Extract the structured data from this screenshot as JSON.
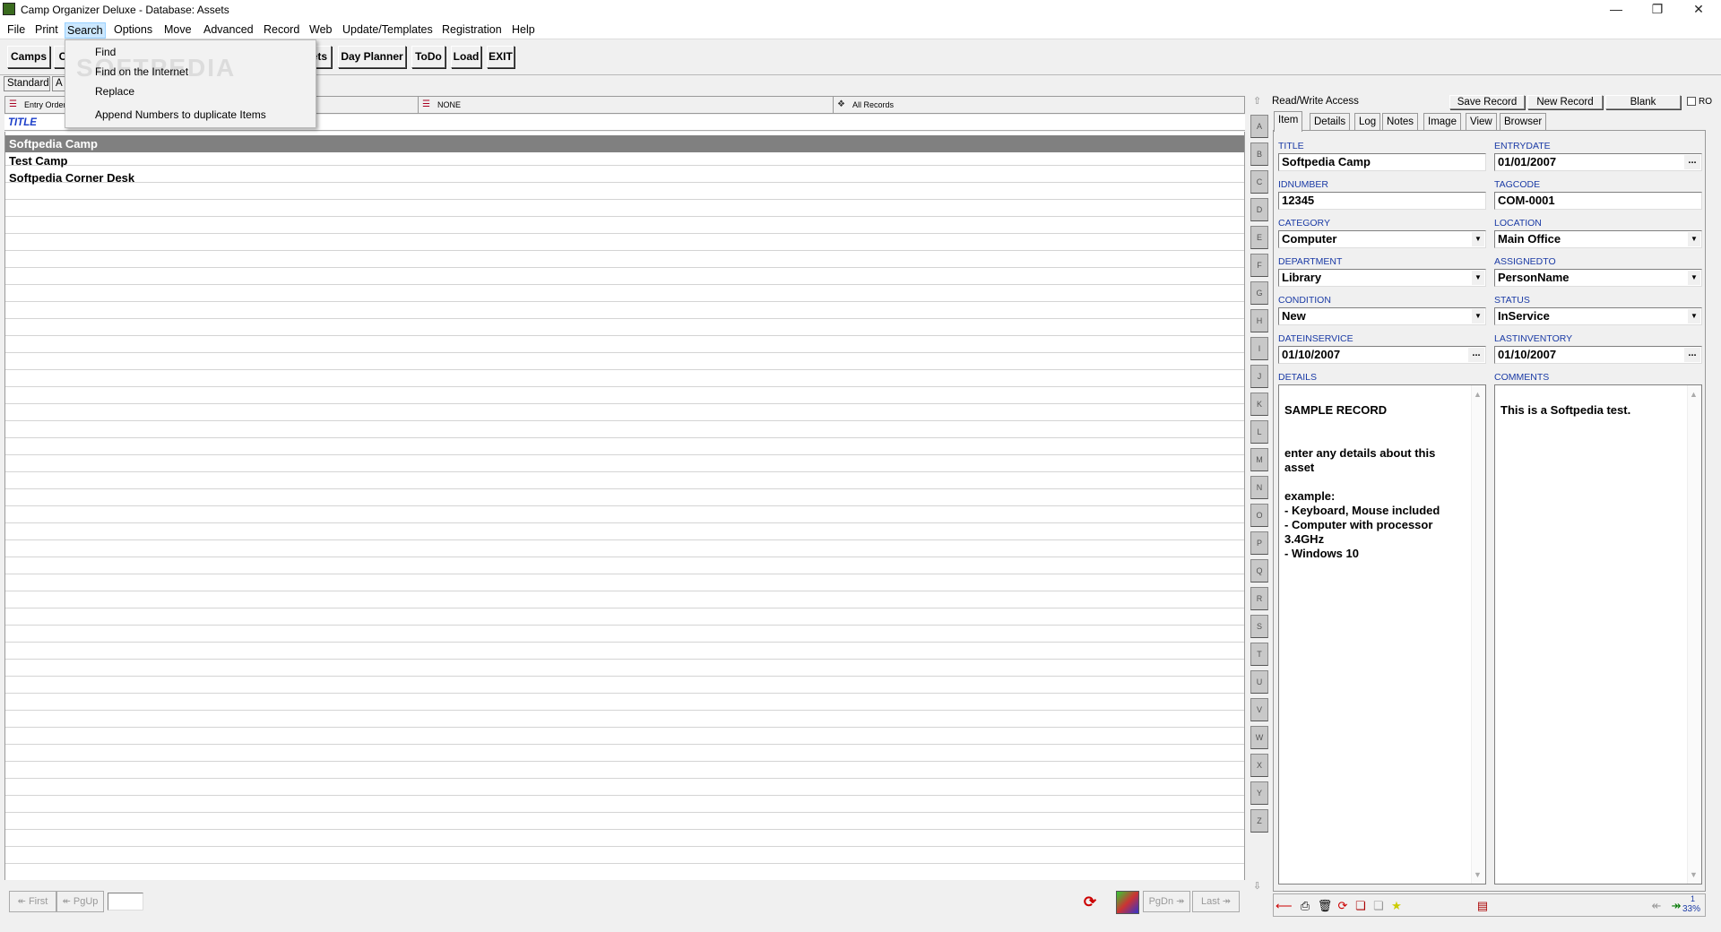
{
  "window": {
    "title": "Camp Organizer Deluxe - Database: Assets"
  },
  "menubar": [
    "File",
    "Print",
    "Search",
    "Options",
    "Move",
    "Advanced",
    "Record",
    "Web",
    "Update/Templates",
    "Registration",
    "Help"
  ],
  "search_menu": {
    "items": [
      "Find",
      "Find on the Internet",
      "Replace",
      "Append Numbers to duplicate Items"
    ],
    "watermark": "SOFTPEDIA"
  },
  "toolbar": {
    "camps": "Camps",
    "c_partial": "C",
    "ets_partial": "ets",
    "day_planner": "Day Planner",
    "todo": "ToDo",
    "load": "Load",
    "exit": "EXIT"
  },
  "viewbar": {
    "standard": "Standard",
    "a_partial": "A"
  },
  "list_header": {
    "order": "Entry Order",
    "filter": "NONE",
    "records": "All Records"
  },
  "column_title": "TITLE",
  "rows": [
    "Softpedia Camp",
    "Test Camp",
    "Softpedia Corner Desk"
  ],
  "alphabet": [
    "A",
    "B",
    "C",
    "D",
    "E",
    "F",
    "G",
    "H",
    "I",
    "J",
    "K",
    "L",
    "M",
    "N",
    "O",
    "P",
    "Q",
    "R",
    "S",
    "T",
    "U",
    "V",
    "W",
    "X",
    "Y",
    "Z"
  ],
  "bottom_nav": {
    "first": "First",
    "pgup": "PgUp",
    "pgdn": "PgDn",
    "last": "Last"
  },
  "record": {
    "access": "Read/Write Access",
    "save": "Save Record",
    "new": "New Record",
    "blank": "Blank",
    "ro": "RO",
    "tabs": [
      "Item",
      "Details",
      "Log",
      "Notes",
      "Image",
      "View",
      "Browser"
    ],
    "fields": {
      "title": {
        "label": "TITLE",
        "value": "Softpedia Camp"
      },
      "entrydate": {
        "label": "ENTRYDATE",
        "value": "01/01/2007"
      },
      "idnumber": {
        "label": "IDNUMBER",
        "value": "12345"
      },
      "tagcode": {
        "label": "TAGCODE",
        "value": "COM-0001"
      },
      "category": {
        "label": "CATEGORY",
        "value": "Computer"
      },
      "location": {
        "label": "LOCATION",
        "value": "Main Office"
      },
      "department": {
        "label": "DEPARTMENT",
        "value": "Library"
      },
      "assignedto": {
        "label": "ASSIGNEDTO",
        "value": "PersonName"
      },
      "condition": {
        "label": "CONDITION",
        "value": "New"
      },
      "status": {
        "label": "STATUS",
        "value": "InService"
      },
      "dateinservice": {
        "label": "DATEINSERVICE",
        "value": "01/10/2007"
      },
      "lastinventory": {
        "label": "LASTINVENTORY",
        "value": "01/10/2007"
      },
      "details": {
        "label": "DETAILS",
        "value": "SAMPLE RECORD\n\n\nenter any details about this asset\n\nexample:\n- Keyboard, Mouse included\n- Computer with processor 3.4GHz\n- Windows 10"
      },
      "comments": {
        "label": "COMMENTS",
        "value": "This is a Softpedia test."
      }
    },
    "zoom": "33%",
    "page_num": "1"
  },
  "colors": {
    "label_blue": "#1a3aa5",
    "selected_row": "#808080",
    "menu_highlight": "#cce8ff"
  }
}
